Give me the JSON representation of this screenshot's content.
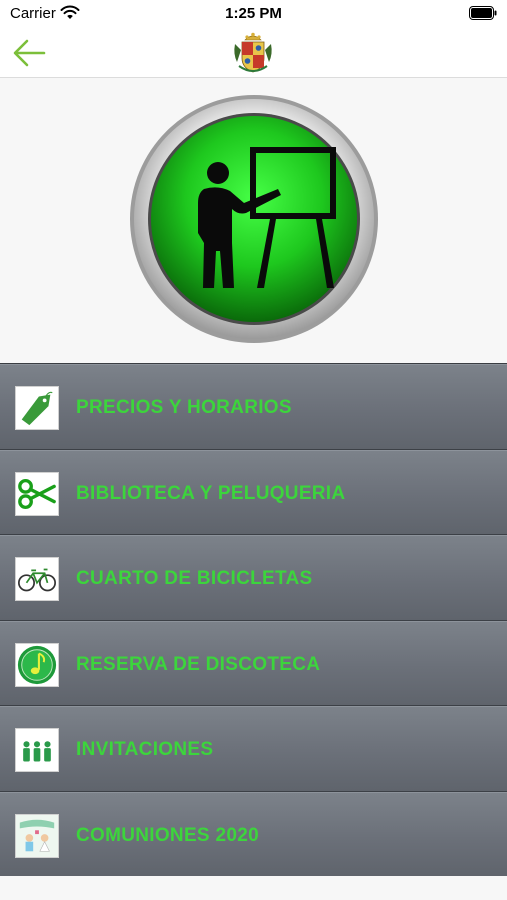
{
  "status_bar": {
    "carrier": "Carrier",
    "time": "1:25 PM",
    "wifi_icon": "wifi-icon",
    "battery_icon": "battery-icon"
  },
  "nav_bar": {
    "back_icon": "arrow-left-icon",
    "logo": "municipal-crest-logo",
    "accent_color": "#7cbf3a"
  },
  "hero": {
    "icon": "teacher-presentation-icon",
    "button_color": "#1ec81e"
  },
  "menu": {
    "items": [
      {
        "label": "PRECIOS Y HORARIOS",
        "icon": "price-tag-icon"
      },
      {
        "label": "BIBLIOTECA Y PELUQUERIA",
        "icon": "scissors-icon"
      },
      {
        "label": "CUARTO DE BICICLETAS",
        "icon": "bicycle-icon"
      },
      {
        "label": "RESERVA DE DISCOTECA",
        "icon": "music-note-icon"
      },
      {
        "label": "INVITACIONES",
        "icon": "people-icon"
      },
      {
        "label": "COMUNIONES 2020",
        "icon": "communion-icon"
      }
    ],
    "label_color": "#3cd53c"
  }
}
